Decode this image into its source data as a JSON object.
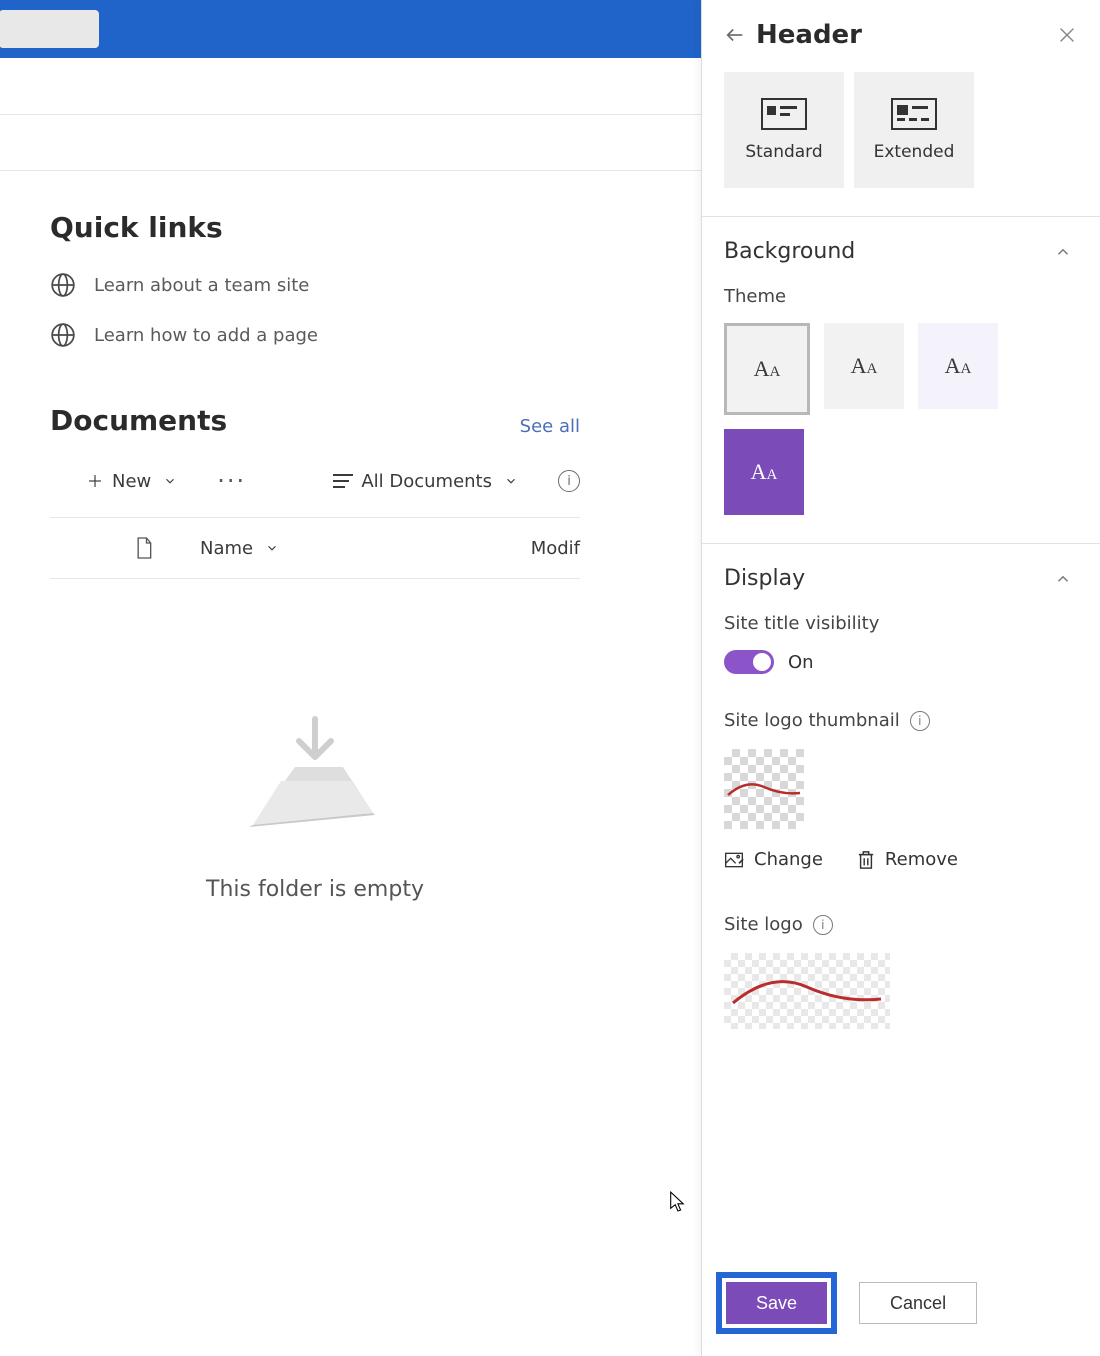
{
  "quicklinks": {
    "title": "Quick links",
    "items": [
      "Learn about a team site",
      "Learn how to add a page"
    ]
  },
  "documents": {
    "title": "Documents",
    "see_all": "See all",
    "new_label": "New",
    "view_label": "All Documents",
    "col_name": "Name",
    "col_modified": "Modif",
    "empty_text": "This folder is empty"
  },
  "panel": {
    "title": "Header",
    "layouts": {
      "standard": "Standard",
      "extended": "Extended"
    },
    "background": {
      "title": "Background",
      "theme_label": "Theme"
    },
    "display": {
      "title": "Display",
      "visibility_label": "Site title visibility",
      "visibility_value": "On",
      "thumb_label": "Site logo thumbnail",
      "logo_label": "Site logo",
      "change": "Change",
      "remove": "Remove"
    },
    "footer": {
      "save": "Save",
      "cancel": "Cancel"
    }
  }
}
